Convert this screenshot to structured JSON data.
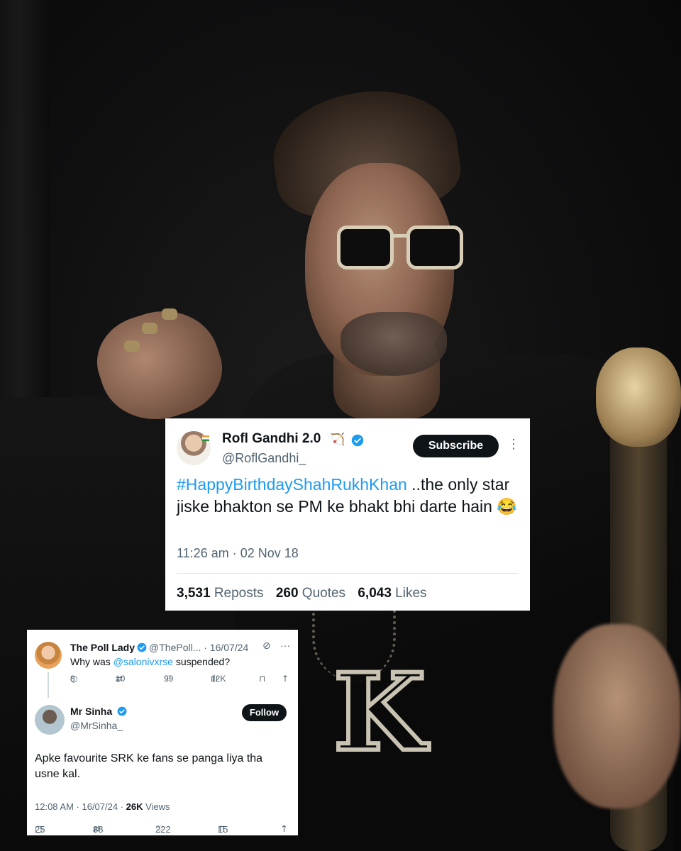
{
  "tweet1": {
    "name": "Rofl Gandhi 2.0",
    "name_emoji": "🏹",
    "handle": "@RoflGandhi_",
    "subscribe_label": "Subscribe",
    "more_icon": "⋮",
    "hashtag": "#HappyBirthdayShahRukhKhan",
    "text": " ..the only star jiske bhakton se PM ke bhakt bhi darte hain 😂",
    "timestamp": "11:26 am · 02 Nov 18",
    "reposts_count": "3,531",
    "reposts_label": "Reposts",
    "quotes_count": "260",
    "quotes_label": "Quotes",
    "likes_count": "6,043",
    "likes_label": "Likes",
    "verified_color": "#1d9bf0"
  },
  "tweet2": {
    "quoted": {
      "name": "The Poll Lady",
      "handle_date": "@ThePoll... · 16/07/24",
      "question_prefix": "Why was ",
      "mention": "@salonivxrse",
      "question_suffix": " suspended?",
      "replies": "8",
      "reposts": "10",
      "likes": "99",
      "views": "12K"
    },
    "reply": {
      "name": "Mr Sinha",
      "handle": "@MrSinha_",
      "follow_label": "Follow",
      "text": "Apke favourite SRK ke fans se panga liya tha usne kal.",
      "time": "12:08 AM · 16/07/24 · ",
      "views_count": "26K",
      "views_label": " Views",
      "replies": "25",
      "reposts": "88",
      "likes": "222",
      "bookmarks": "15"
    }
  },
  "icons": {
    "reply": "○",
    "repost": "⇄",
    "like": "♡",
    "views": "📊",
    "bookmark": "⊓",
    "share": "↑",
    "grok": "⊘",
    "more": "···"
  }
}
